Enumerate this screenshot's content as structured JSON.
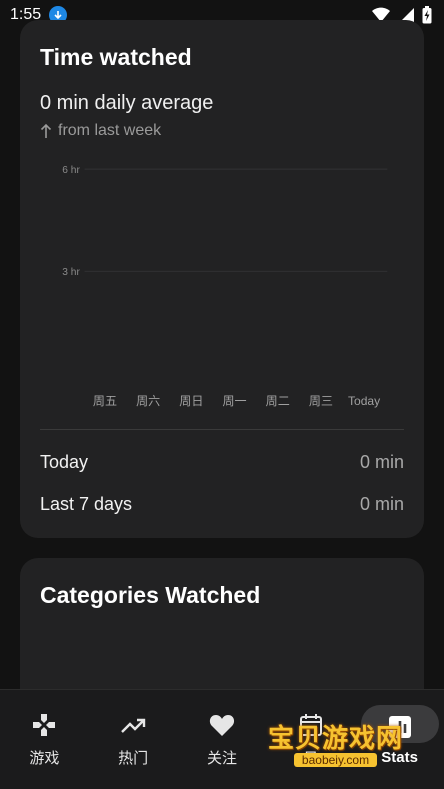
{
  "status_bar": {
    "time": "1:55",
    "icons": [
      "download-icon",
      "wifi-icon",
      "signal-icon",
      "battery-charging-icon"
    ]
  },
  "time_watched": {
    "title": "Time watched",
    "daily_average": "0 min daily average",
    "trend_text": "from last week",
    "trend_icon": "arrow-up-icon",
    "today_label": "Today",
    "today_value": "0 min",
    "week_label": "Last 7 days",
    "week_value": "0 min"
  },
  "chart_data": {
    "type": "bar",
    "categories": [
      "周五",
      "周六",
      "周日",
      "周一",
      "周二",
      "周三",
      "Today"
    ],
    "values": [
      0,
      0,
      0,
      0,
      0,
      0,
      0
    ],
    "title": "",
    "xlabel": "",
    "ylabel": "",
    "yticks": [
      "6 hr",
      "3 hr"
    ],
    "ylim": [
      0,
      6
    ],
    "grid": true
  },
  "categories_watched": {
    "title": "Categories Watched"
  },
  "bottom_nav": {
    "items": [
      {
        "label": "游戏",
        "icon": "gamepad-icon"
      },
      {
        "label": "热门",
        "icon": "trending-icon"
      },
      {
        "label": "关注",
        "icon": "heart-icon"
      },
      {
        "label": "日",
        "icon": "calendar-icon"
      },
      {
        "label": "Stats",
        "icon": "stats-icon"
      }
    ]
  },
  "watermark": {
    "text": "宝贝游戏网",
    "url": "baobeiy.com"
  },
  "colors": {
    "background": "#121212",
    "card": "#222223",
    "muted_text": "#a8a8a8",
    "accent_download": "#1e88e5"
  }
}
